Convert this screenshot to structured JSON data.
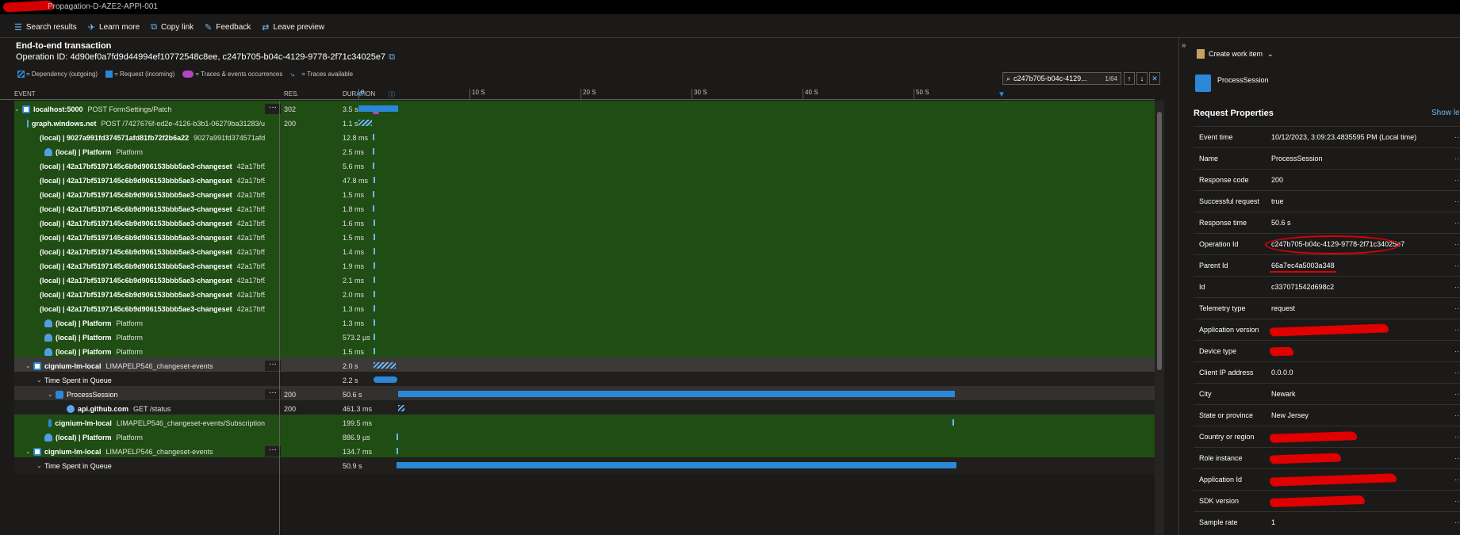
{
  "window": {
    "title_visible": "Propagation-D-AZE2-APPI-001"
  },
  "toolbar": [
    {
      "icon": "list-icon",
      "label": "Search results"
    },
    {
      "icon": "learn-icon",
      "label": "Learn more"
    },
    {
      "icon": "copy-link-icon",
      "label": "Copy link"
    },
    {
      "icon": "feedback-icon",
      "label": "Feedback"
    },
    {
      "icon": "leave-preview-icon",
      "label": "Leave preview"
    }
  ],
  "header": {
    "title": "End-to-end transaction",
    "operation_id": "Operation ID: 4d90ef0a7fd9d44994ef10772548c8ee, c247b705-b04c-4129-9778-2f71c34025e7"
  },
  "legend": [
    {
      "key": "dep",
      "label": "= Dependency (outgoing)"
    },
    {
      "key": "req",
      "label": "= Request (incoming)"
    },
    {
      "key": "tr",
      "label": "= Traces & events occurrences"
    },
    {
      "key": "ta",
      "label": "= Traces available"
    }
  ],
  "search": {
    "value": "c247b705-b04c-4129...",
    "count": "1/64"
  },
  "columns": {
    "event": "EVENT",
    "res": "RES.",
    "duration": "DURATION"
  },
  "timeline_ticks": [
    "0",
    "10 S",
    "20 S",
    "30 S",
    "40 S",
    "50 S"
  ],
  "rows": [
    {
      "name": "localhost:5000",
      "detail": "POST FormSettings/Patch",
      "res": "302",
      "dur": "3.5 s",
      "style": "green"
    },
    {
      "name": "graph.windows.net",
      "detail": "POST /7427676f-ed2e-4126-b3b1-06279ba31283/u",
      "res": "200",
      "dur": "1.1 s",
      "style": "green"
    },
    {
      "name": "(local) | 9027a991fd374571afd81fb72f2b6a22",
      "detail": "9027a991fd374571afd8",
      "res": "",
      "dur": "12.8 ms",
      "style": "green"
    },
    {
      "name": "(local) | Platform",
      "detail": "Platform",
      "res": "",
      "dur": "2.5 ms",
      "style": "green"
    },
    {
      "name": "(local) | 42a17bf5197145c6b9d906153bbb5ae3-changeset",
      "detail": "42a17bf51",
      "res": "",
      "dur": "5.6 ms",
      "style": "green"
    },
    {
      "name": "(local) | 42a17bf5197145c6b9d906153bbb5ae3-changeset",
      "detail": "42a17bf51",
      "res": "",
      "dur": "47.8 ms",
      "style": "green"
    },
    {
      "name": "(local) | 42a17bf5197145c6b9d906153bbb5ae3-changeset",
      "detail": "42a17bf51",
      "res": "",
      "dur": "1.5 ms",
      "style": "green"
    },
    {
      "name": "(local) | 42a17bf5197145c6b9d906153bbb5ae3-changeset",
      "detail": "42a17bf51",
      "res": "",
      "dur": "1.8 ms",
      "style": "green"
    },
    {
      "name": "(local) | 42a17bf5197145c6b9d906153bbb5ae3-changeset",
      "detail": "42a17bf51",
      "res": "",
      "dur": "1.6 ms",
      "style": "green"
    },
    {
      "name": "(local) | 42a17bf5197145c6b9d906153bbb5ae3-changeset",
      "detail": "42a17bf51",
      "res": "",
      "dur": "1.5 ms",
      "style": "green"
    },
    {
      "name": "(local) | 42a17bf5197145c6b9d906153bbb5ae3-changeset",
      "detail": "42a17bf51",
      "res": "",
      "dur": "1.4 ms",
      "style": "green"
    },
    {
      "name": "(local) | 42a17bf5197145c6b9d906153bbb5ae3-changeset",
      "detail": "42a17bf51",
      "res": "",
      "dur": "1.9 ms",
      "style": "green"
    },
    {
      "name": "(local) | 42a17bf5197145c6b9d906153bbb5ae3-changeset",
      "detail": "42a17bf51",
      "res": "",
      "dur": "2.1 ms",
      "style": "green"
    },
    {
      "name": "(local) | 42a17bf5197145c6b9d906153bbb5ae3-changeset",
      "detail": "42a17bf51",
      "res": "",
      "dur": "2.0 ms",
      "style": "green"
    },
    {
      "name": "(local) | 42a17bf5197145c6b9d906153bbb5ae3-changeset",
      "detail": "42a17bf51",
      "res": "",
      "dur": "1.3 ms",
      "style": "green"
    },
    {
      "name": "(local) | Platform",
      "detail": "Platform",
      "res": "",
      "dur": "1.3 ms",
      "style": "green"
    },
    {
      "name": "(local) | Platform",
      "detail": "Platform",
      "res": "",
      "dur": "573.2 µs",
      "style": "green"
    },
    {
      "name": "(local) | Platform",
      "detail": "Platform",
      "res": "",
      "dur": "1.5 ms",
      "style": "green"
    },
    {
      "name": "cignium-lm-local",
      "detail": "LIMAPELP546_changeset-events",
      "res": "",
      "dur": "2.0 s",
      "style": "gray"
    },
    {
      "name": "Time Spent in Queue",
      "detail": "",
      "res": "",
      "dur": "2.2 s",
      "style": "dark"
    },
    {
      "name": "ProcessSession",
      "detail": "",
      "res": "200",
      "dur": "50.6 s",
      "style": "hl"
    },
    {
      "name": "api.github.com",
      "detail": "GET /status",
      "res": "200",
      "dur": "461.3 ms",
      "style": "dark"
    },
    {
      "name": "cignium-lm-local",
      "detail": "LIMAPELP546_changeset-events/Subscription",
      "res": "",
      "dur": "199.5 ms",
      "style": "green"
    },
    {
      "name": "(local) | Platform",
      "detail": "Platform",
      "res": "",
      "dur": "886.9 µs",
      "style": "green"
    },
    {
      "name": "cignium-lm-local",
      "detail": "LIMAPELP546_changeset-events",
      "res": "",
      "dur": "134.7 ms",
      "style": "green"
    },
    {
      "name": "Time Spent in Queue",
      "detail": "",
      "res": "",
      "dur": "50.9 s",
      "style": "dark"
    }
  ],
  "right_panel": {
    "create_work_item": "Create work item",
    "item_name": "ProcessSession",
    "section_title": "Request Properties",
    "show_link": "Show le",
    "properties": [
      {
        "key": "Event time",
        "value": "10/12/2023, 3:09:23.4835595 PM (Local time)"
      },
      {
        "key": "Name",
        "value": "ProcessSession"
      },
      {
        "key": "Response code",
        "value": "200"
      },
      {
        "key": "Successful request",
        "value": "true"
      },
      {
        "key": "Response time",
        "value": "50.6 s"
      },
      {
        "key": "Operation Id",
        "value": "c247b705-b04c-4129-9778-2f71c34025e7"
      },
      {
        "key": "Parent Id",
        "value": "66a7ec4a5003a348"
      },
      {
        "key": "Id",
        "value": "c337071542d698c2"
      },
      {
        "key": "Telemetry type",
        "value": "request"
      },
      {
        "key": "Application version",
        "value": ""
      },
      {
        "key": "Device type",
        "value": ""
      },
      {
        "key": "Client IP address",
        "value": "0.0.0.0"
      },
      {
        "key": "City",
        "value": "Newark"
      },
      {
        "key": "State or province",
        "value": "New Jersey"
      },
      {
        "key": "Country or region",
        "value": ""
      },
      {
        "key": "Role instance",
        "value": ""
      },
      {
        "key": "Application Id",
        "value": ""
      },
      {
        "key": "SDK version",
        "value": ""
      },
      {
        "key": "Sample rate",
        "value": "1"
      }
    ]
  },
  "colors": {
    "accent": "#2b88d8",
    "row_green": "#1f4d13",
    "redaction": "#e00000"
  }
}
